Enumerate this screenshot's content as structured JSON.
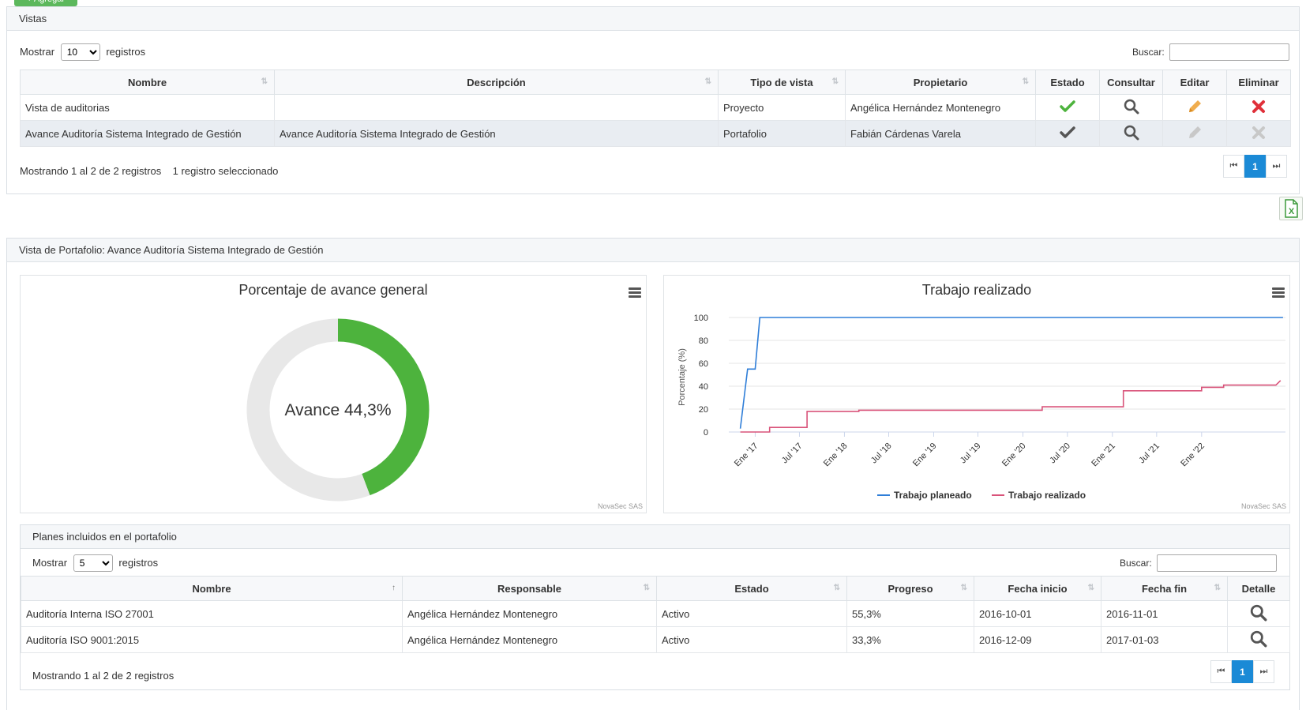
{
  "top_button": {
    "label": "+ Agregar"
  },
  "views_panel": {
    "title": "Vistas",
    "show_label": "Mostrar",
    "show_value": "10",
    "records_label": "registros",
    "search_label": "Buscar:",
    "columns": [
      "Nombre",
      "Descripción",
      "Tipo de vista",
      "Propietario",
      "Estado",
      "Consultar",
      "Editar",
      "Eliminar"
    ],
    "rows": [
      {
        "nombre": "Vista de auditorias",
        "descripcion": "",
        "tipo": "Proyecto",
        "propietario": "Angélica Hernández Montenegro"
      },
      {
        "nombre": "Avance Auditoría Sistema Integrado de Gestión",
        "descripcion": "Avance Auditoría Sistema Integrado de Gestión",
        "tipo": "Portafolio",
        "propietario": "Fabián Cárdenas Varela"
      }
    ],
    "info": "Mostrando 1 al 2 de 2 registros",
    "selected_info": "1 registro seleccionado",
    "page": "1"
  },
  "portfolio_panel": {
    "title": "Vista de Portafolio: Avance Auditoría Sistema Integrado de Gestión",
    "credits": "NovaSec SAS"
  },
  "colors": {
    "accent_blue": "#1b8ad6",
    "green": "#4db33d",
    "red": "#e0303a",
    "orange": "#f0ad4e",
    "planned_line": "#2f7ed8",
    "actual_line": "#d9537a"
  },
  "chart_data": [
    {
      "type": "pie",
      "title": "Porcentaje de avance general",
      "center_label": "Avance 44,3%",
      "values": [
        44.3,
        55.7
      ]
    },
    {
      "type": "line",
      "title": "Trabajo realizado",
      "ylabel": "Porcentaje (%)",
      "ylim": [
        0,
        100
      ],
      "yticks": [
        0,
        20,
        40,
        60,
        80,
        100
      ],
      "xticks": [
        "Ene '17",
        "Jul '17",
        "Ene '18",
        "Jul '18",
        "Ene '19",
        "Jul '19",
        "Ene '20",
        "Jul '20",
        "Ene '21",
        "Jul '21",
        "Ene '22"
      ],
      "legend_position": "bottom",
      "series": [
        {
          "name": "Trabajo planeado",
          "x": [
            "2016-11-01",
            "2016-12-01",
            "2016-12-01",
            "2017-01-01",
            "2017-01-20",
            "2022-11-30"
          ],
          "y": [
            3,
            55,
            55,
            55,
            100,
            100
          ]
        },
        {
          "name": "Trabajo realizado",
          "x": [
            "2016-11-01",
            "2017-03-01",
            "2017-03-01",
            "2017-08-01",
            "2017-08-01",
            "2018-03-01",
            "2018-03-01",
            "2020-03-20",
            "2020-03-20",
            "2021-02-15",
            "2021-02-15",
            "2022-01-01",
            "2022-01-01",
            "2022-04-01",
            "2022-04-01",
            "2022-11-01",
            "2022-11-20"
          ],
          "y": [
            0,
            0,
            4,
            4,
            18,
            18,
            19,
            19,
            22,
            22,
            36,
            36,
            39,
            39,
            41,
            41,
            45
          ]
        }
      ]
    }
  ],
  "plans_panel": {
    "title": "Planes incluidos en el portafolio",
    "show_label": "Mostrar",
    "show_value": "5",
    "records_label": "registros",
    "search_label": "Buscar:",
    "columns": [
      "Nombre",
      "Responsable",
      "Estado",
      "Progreso",
      "Fecha inicio",
      "Fecha fin",
      "Detalle"
    ],
    "rows": [
      {
        "nombre": "Auditoría Interna ISO 27001",
        "responsable": "Angélica Hernández Montenegro",
        "estado": "Activo",
        "progreso": "55,3%",
        "inicio": "2016-10-01",
        "fin": "2016-11-01"
      },
      {
        "nombre": "Auditoría ISO 9001:2015",
        "responsable": "Angélica Hernández Montenegro",
        "estado": "Activo",
        "progreso": "33,3%",
        "inicio": "2016-12-09",
        "fin": "2017-01-03"
      }
    ],
    "info": "Mostrando 1 al 2 de 2 registros",
    "page": "1"
  }
}
